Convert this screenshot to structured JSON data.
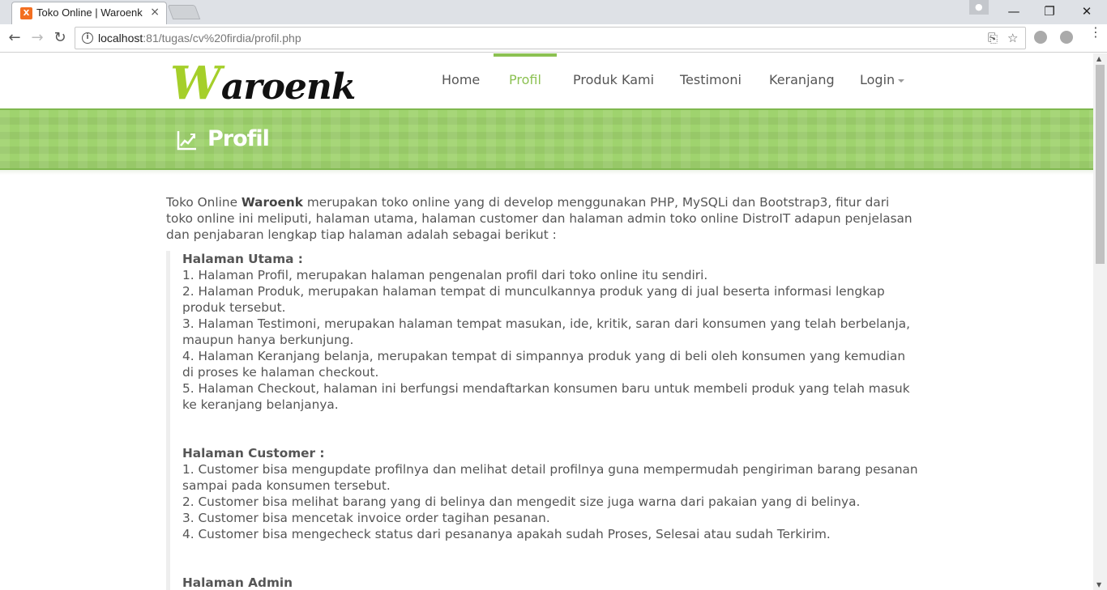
{
  "browser": {
    "tab_title": "Toko Online | Waroenk",
    "tab_favicon": "X",
    "tab_close": "×",
    "url_host": "localhost",
    "url_rest": ":81/tugas/cv%20firdia/profil.php",
    "back_icon": "←",
    "forward_icon": "→",
    "reload_icon": "↻",
    "translate_icon": "⎘",
    "bookmark_icon": "☆",
    "minimize_icon": "—",
    "restore_icon": "❐",
    "close_icon": "✕",
    "menu_icon": "⋮"
  },
  "site": {
    "logo_first": "W",
    "logo_rest": "aroenk",
    "menu": {
      "home": "Home",
      "profil": "Profil",
      "produk": "Produk Kami",
      "testimoni": "Testimoni",
      "keranjang": "Keranjang",
      "login": "Login"
    },
    "banner_title": "Profil",
    "colors": {
      "accent": "#8cc152",
      "banner": "#9fd36e",
      "logo_w": "#a5cf2a"
    }
  },
  "content": {
    "intro_pre": "Toko Online ",
    "intro_bold": "Waroenk",
    "intro_post": " merupakan toko online yang di develop menggunakan PHP, MySQLi dan Bootstrap3, fitur dari toko online ini meliputi, halaman utama, halaman customer dan halaman admin toko online DistroIT adapun penjelasan dan penjabaran lengkap tiap halaman adalah sebagai berikut :",
    "utama_heading": "Halaman Utama :",
    "utama_items": [
      "1. Halaman Profil, merupakan halaman pengenalan profil dari toko online itu sendiri.",
      "2. Halaman Produk, merupakan halaman tempat di munculkannya produk yang di jual beserta informasi lengkap produk tersebut.",
      "3. Halaman Testimoni, merupakan halaman tempat masukan, ide, kritik, saran dari konsumen yang telah berbelanja, maupun hanya berkunjung.",
      "4. Halaman Keranjang belanja, merupakan tempat di simpannya produk yang di beli oleh konsumen yang kemudian di proses ke halaman checkout.",
      "5. Halaman Checkout, halaman ini berfungsi mendaftarkan konsumen baru untuk membeli produk yang telah masuk ke keranjang belanjanya."
    ],
    "customer_heading": "Halaman Customer :",
    "customer_items": [
      "1. Customer bisa mengupdate profilnya dan melihat detail profilnya guna mempermudah pengiriman barang pesanan sampai pada konsumen tersebut.",
      "2. Customer bisa melihat barang yang di belinya dan mengedit size juga warna dari pakaian yang di belinya.",
      "3. Customer bisa mencetak invoice order tagihan pesanan.",
      "4. Customer bisa mengecheck status dari pesananya apakah sudah Proses, Selesai atau sudah Terkirim."
    ],
    "admin_heading": "Halaman Admin"
  }
}
